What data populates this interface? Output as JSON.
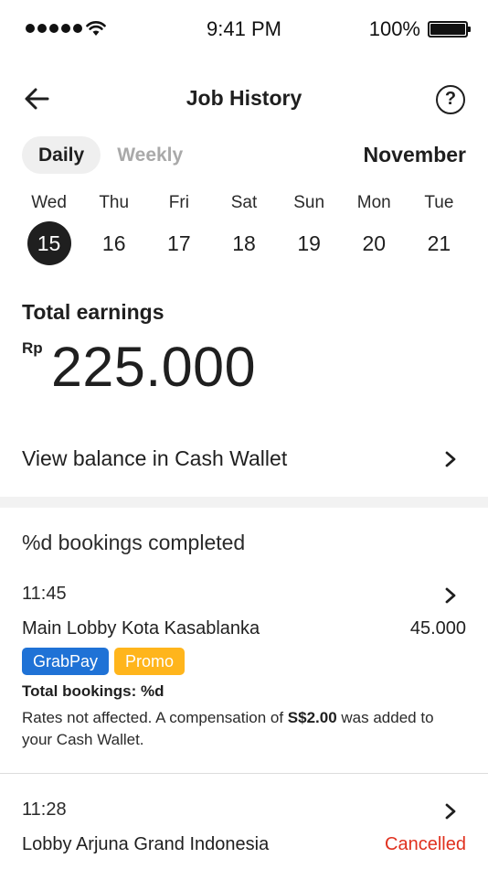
{
  "status_bar": {
    "time": "9:41 PM",
    "battery": "100%",
    "icons": [
      "signal-dots-icon",
      "wifi-icon",
      "battery-icon"
    ]
  },
  "header": {
    "title": "Job History",
    "back_icon": "arrow-left-icon",
    "help_icon": "help-circle-icon",
    "help_glyph": "?"
  },
  "period": {
    "tabs": [
      {
        "label": "Daily",
        "active": true
      },
      {
        "label": "Weekly",
        "active": false
      }
    ],
    "month": "November"
  },
  "week": {
    "days": [
      {
        "dow": "Wed",
        "date": "15",
        "selected": true
      },
      {
        "dow": "Thu",
        "date": "16",
        "selected": false
      },
      {
        "dow": "Fri",
        "date": "17",
        "selected": false
      },
      {
        "dow": "Sat",
        "date": "18",
        "selected": false
      },
      {
        "dow": "Sun",
        "date": "19",
        "selected": false
      },
      {
        "dow": "Mon",
        "date": "20",
        "selected": false
      },
      {
        "dow": "Tue",
        "date": "21",
        "selected": false
      }
    ]
  },
  "earnings": {
    "label": "Total earnings",
    "currency": "Rp",
    "amount": "225.000"
  },
  "wallet": {
    "label": "View balance in Cash Wallet",
    "chevron_icon": "chevron-right-icon"
  },
  "bookings": {
    "section_title": "%d bookings completed",
    "items": [
      {
        "time": "11:45",
        "location": "Main Lobby Kota Kasablanka",
        "price": "45.000",
        "badges": [
          {
            "label": "GrabPay",
            "color": "#1f72d6"
          },
          {
            "label": "Promo",
            "color": "#ffb51c"
          }
        ],
        "total_bookings": "Total bookings: %d",
        "note_prefix": "Rates not affected. A compensation of ",
        "note_amount": "S$2.00",
        "note_suffix": " was added to your Cash Wallet."
      },
      {
        "time": "11:28",
        "location": "Lobby Arjuna Grand Indonesia",
        "status": "Cancelled",
        "status_color": "#e0301e"
      }
    ]
  },
  "colors": {
    "text": "#1f1f1f",
    "muted": "#a9a9a9",
    "selected_day_bg": "#1f1f1f",
    "tab_active_bg": "#efefef",
    "section_divider": "#f2f2f2"
  }
}
